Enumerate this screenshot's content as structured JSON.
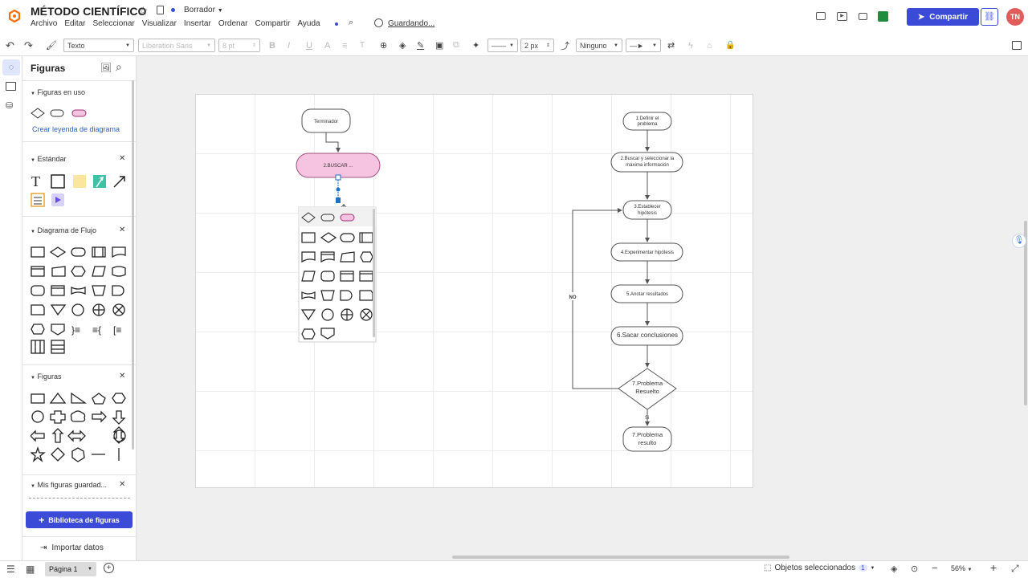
{
  "header": {
    "doc_title": "MÉTODO CIENTÍFICO",
    "status": "Borrador",
    "saving": "Guardando...",
    "menu": [
      "Archivo",
      "Editar",
      "Seleccionar",
      "Visualizar",
      "Insertar",
      "Ordenar",
      "Compartir",
      "Ayuda"
    ],
    "share_label": "Compartir",
    "avatar_initials": "TN",
    "brand_color": "#ff6d00",
    "accent_color": "#3b4bd8"
  },
  "toolbar": {
    "text_style": "Texto",
    "font_family": "Liberation Sans",
    "font_size": "8 pt",
    "line_width": "2 px",
    "arrow_start": "Ninguno"
  },
  "panel": {
    "title": "Figuras",
    "sections": {
      "in_use": "Figuras en uso",
      "legend_link": "Crear leyenda de diagrama",
      "standard": "Estándar",
      "flowchart": "Diagrama de Flujo",
      "shapes": "Figuras",
      "my_shapes": "Mis figuras guardad..."
    },
    "library_button": "Biblioteca de figuras",
    "import_button": "Importar datos"
  },
  "diagram": {
    "left": {
      "terminator": "Terminador",
      "buscar": "2.BUSCAR ..."
    },
    "right": {
      "step1": [
        "1.Definir el",
        "problema"
      ],
      "step2": [
        "2.Buscar y seleccionar la",
        "máxima información"
      ],
      "step3": [
        "3.Establecer",
        "hipótesis"
      ],
      "step4": "4.Experimentar hipótesis",
      "step5": "5.Anotar resultados",
      "step6": "6.Sacar  conclusiones",
      "step7": [
        "7.Problema",
        "Resuelto"
      ],
      "step8": [
        "7.Problema",
        "resulto"
      ],
      "no_label": "NO",
      "si_label": "Si"
    }
  },
  "statusbar": {
    "page": "Página 1",
    "selected": "Objetos seleccionados",
    "selected_count": "1",
    "zoom": "56%"
  }
}
